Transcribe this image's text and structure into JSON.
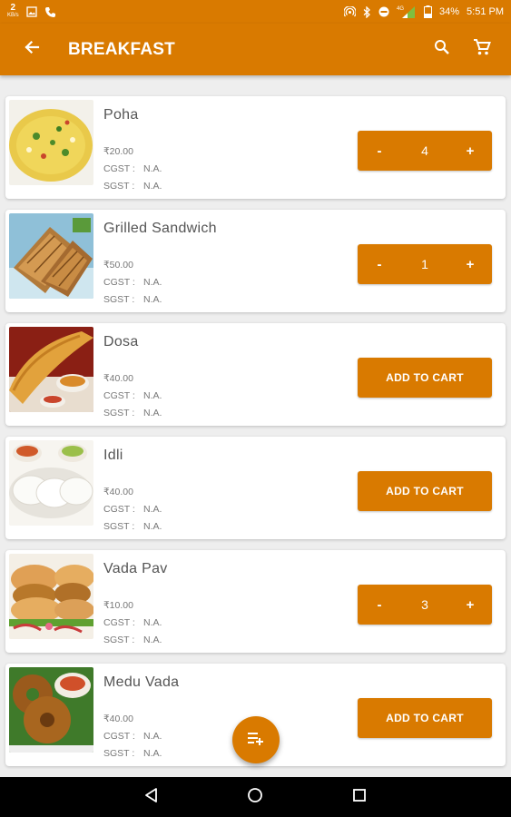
{
  "status_bar": {
    "network_count": "2",
    "network_unit": "KB/s",
    "network_type": "4G",
    "battery": "34%",
    "time": "5:51 PM"
  },
  "app_bar": {
    "title": "BREAKFAST",
    "back_icon": "arrow-back-icon",
    "search_icon": "search-icon",
    "cart_icon": "cart-icon"
  },
  "colors": {
    "accent": "#d97a00",
    "background": "#eeeeee",
    "card": "#ffffff",
    "text_primary": "#555555",
    "text_secondary": "#777777"
  },
  "labels": {
    "cgst": "CGST :",
    "sgst": "SGST :",
    "add_to_cart": "ADD TO CART",
    "minus": "-",
    "plus": "+"
  },
  "items": [
    {
      "name": "Poha",
      "price": "₹20.00",
      "cgst": "N.A.",
      "sgst": "N.A.",
      "quantity": "4",
      "in_cart": true
    },
    {
      "name": "Grilled Sandwich",
      "price": "₹50.00",
      "cgst": "N.A.",
      "sgst": "N.A.",
      "quantity": "1",
      "in_cart": true
    },
    {
      "name": "Dosa",
      "price": "₹40.00",
      "cgst": "N.A.",
      "sgst": "N.A.",
      "quantity": "",
      "in_cart": false
    },
    {
      "name": "Idli",
      "price": "₹40.00",
      "cgst": "N.A.",
      "sgst": "N.A.",
      "quantity": "",
      "in_cart": false
    },
    {
      "name": "Vada Pav",
      "price": "₹10.00",
      "cgst": "N.A.",
      "sgst": "N.A.",
      "quantity": "3",
      "in_cart": true
    },
    {
      "name": "Medu Vada",
      "price": "₹40.00",
      "cgst": "N.A.",
      "sgst": "N.A.",
      "quantity": "",
      "in_cart": false
    }
  ],
  "fab": {
    "icon": "playlist-add-icon"
  },
  "nav_bar": {
    "back_icon": "nav-back-icon",
    "home_icon": "nav-home-icon",
    "recents_icon": "nav-recents-icon"
  }
}
